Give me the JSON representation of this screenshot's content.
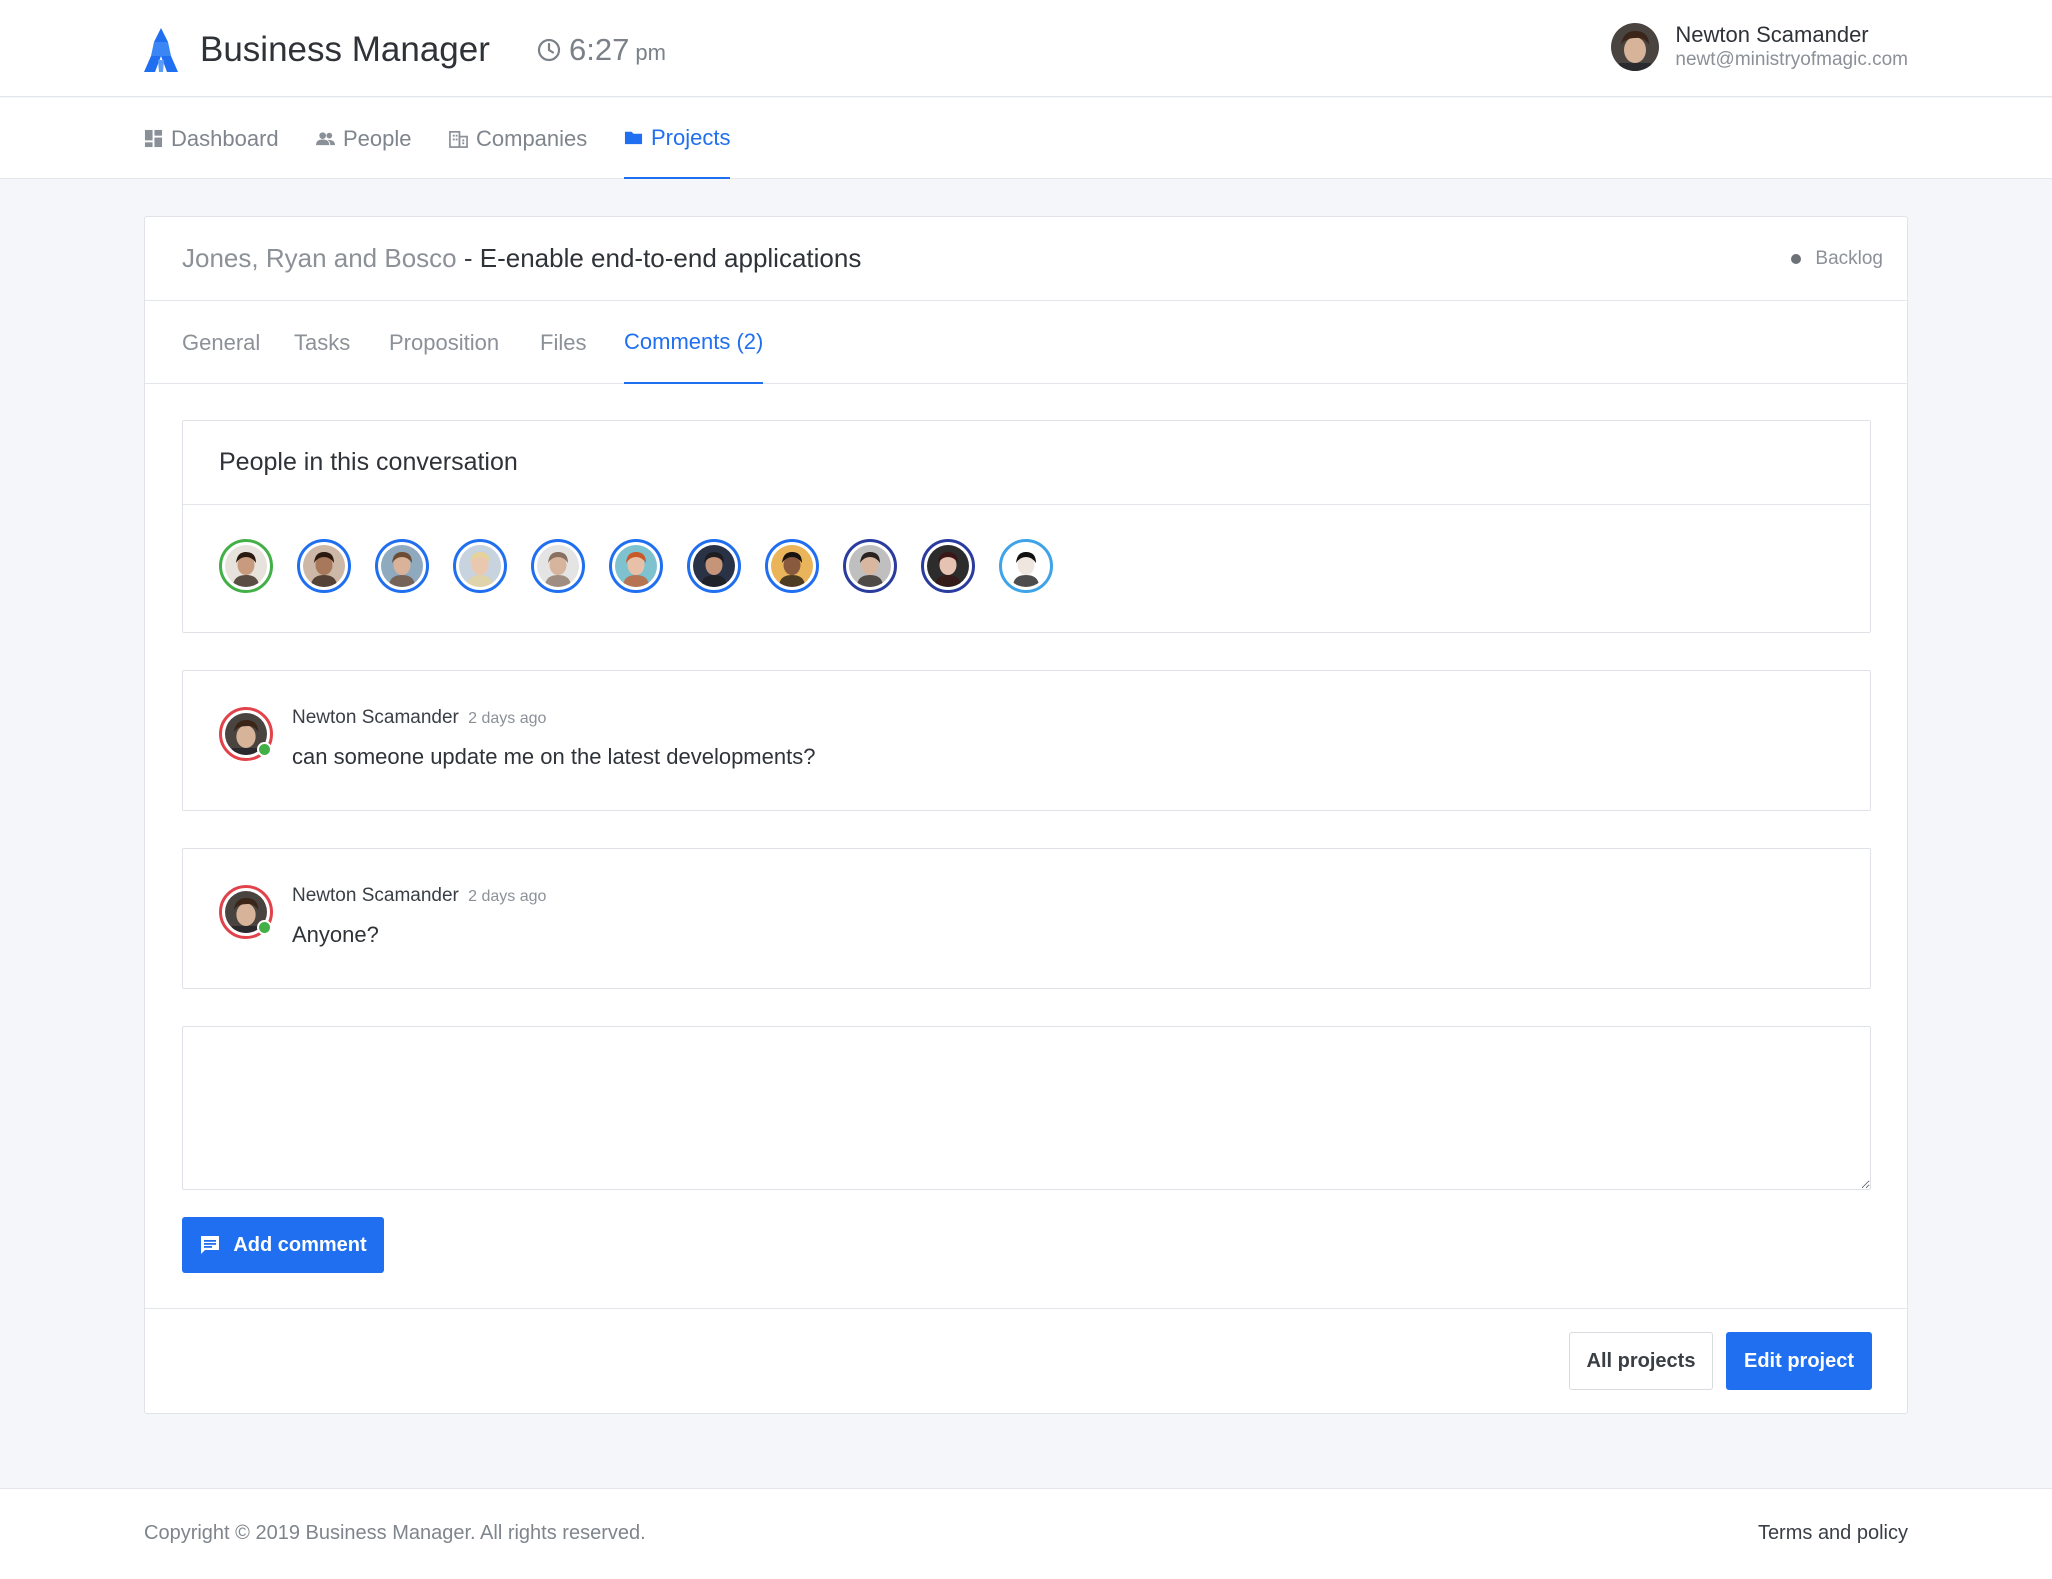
{
  "app": {
    "name": "Business Manager",
    "time": "6:27",
    "ampm": "pm"
  },
  "user": {
    "name": "Newton Scamander",
    "email": "newt@ministryofmagic.com"
  },
  "nav": {
    "dashboard": "Dashboard",
    "people": "People",
    "companies": "Companies",
    "projects": "Projects"
  },
  "project": {
    "company": "Jones, Ryan and Bosco",
    "separator": " - ",
    "name": "E-enable end-to-end applications",
    "status": "Backlog"
  },
  "tabs": {
    "general": "General",
    "tasks": "Tasks",
    "proposition": "Proposition",
    "files": "Files",
    "comments": "Comments (2)"
  },
  "conversation": {
    "title": "People in this conversation",
    "participants": [
      {
        "ring": "green",
        "skin": "#c89a7e",
        "hair": "#2a1b12",
        "bg": "#e8e2dc"
      },
      {
        "ring": "blue",
        "skin": "#a8785a",
        "hair": "#2c1a10",
        "bg": "#cdb7a6"
      },
      {
        "ring": "blue",
        "skin": "#d9b299",
        "hair": "#6d4c36",
        "bg": "#8fa9bf"
      },
      {
        "ring": "blue",
        "skin": "#eac8b0",
        "hair": "#e6d39a",
        "bg": "#c7d3de"
      },
      {
        "ring": "blue",
        "skin": "#d6b49e",
        "hair": "#8a7060",
        "bg": "#e4e4e4"
      },
      {
        "ring": "blue",
        "skin": "#e8c0a8",
        "hair": "#c85a2a",
        "bg": "#7fc2cf"
      },
      {
        "ring": "blue",
        "skin": "#c69478",
        "hair": "#1d1d22",
        "bg": "#2a3346"
      },
      {
        "ring": "blue",
        "skin": "#8a5a3e",
        "hair": "#1a1410",
        "bg": "#e9b45a"
      },
      {
        "ring": "navy",
        "skin": "#d8b6a0",
        "hair": "#2a2220",
        "bg": "#bfbfbf"
      },
      {
        "ring": "navy",
        "skin": "#e6c2b2",
        "hair": "#3a1616",
        "bg": "#2c2c2c"
      },
      {
        "ring": "sky",
        "skin": "#f0e6e0",
        "hair": "#111111",
        "bg": "#ffffff"
      }
    ]
  },
  "comments": [
    {
      "author": "Newton Scamander",
      "time": "2 days ago",
      "text": "can someone update me on the latest developments?"
    },
    {
      "author": "Newton Scamander",
      "time": "2 days ago",
      "text": "Anyone?"
    }
  ],
  "comment_input": {
    "value": "",
    "placeholder": ""
  },
  "buttons": {
    "add_comment": "Add comment",
    "all_projects": "All projects",
    "edit_project": "Edit project"
  },
  "footer": {
    "copyright": "Copyright © 2019 Business Manager. All rights reserved.",
    "terms": "Terms and policy"
  },
  "colors": {
    "accent": "#1f6ff0",
    "online": "#43b047",
    "author_ring": "#e2424a"
  }
}
